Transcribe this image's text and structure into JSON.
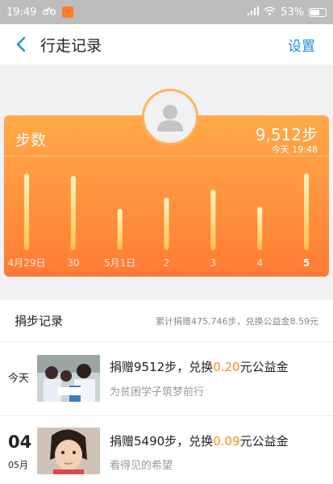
{
  "status_bar": {
    "time": "19:49",
    "battery": "53%"
  },
  "nav": {
    "title": "行走记录",
    "settings": "设置"
  },
  "card": {
    "label": "步数",
    "total_steps": "9,512步",
    "updated": "今天 19:48",
    "accent": "#ff8b3c"
  },
  "chart_data": {
    "type": "bar",
    "categories": [
      "4月29日",
      "30",
      "5月1日",
      "2",
      "3",
      "4",
      "5"
    ],
    "values": [
      9500,
      9200,
      5100,
      6500,
      7500,
      5400,
      9512
    ],
    "ylim": [
      0,
      10000
    ]
  },
  "donations": {
    "title": "捐步记录",
    "summary": "累计捐赠475,746步，兑换公益金8.59元",
    "records": [
      {
        "day": "今天",
        "month": "",
        "main_prefix": "捐赠9512步，兑换",
        "amount": "0.20",
        "main_suffix": "元公益金",
        "subtitle": "为贫困学子筑梦前行"
      },
      {
        "day": "04",
        "month": "05月",
        "main_prefix": "捐赠5490步，兑换",
        "amount": "0.09",
        "main_suffix": "元公益金",
        "subtitle": "看得见的希望"
      }
    ]
  }
}
